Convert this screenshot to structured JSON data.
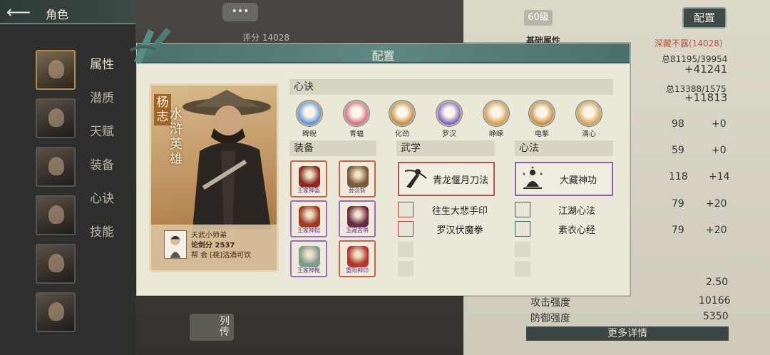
{
  "topbar": {
    "back_icon": "arrow-left-icon",
    "title": "角色"
  },
  "side_menu": [
    "属性",
    "潜质",
    "天赋",
    "装备",
    "心诀",
    "技能"
  ],
  "chat_bubble": "•••",
  "score_tag": "评分 14028",
  "lie_button": "列\n传",
  "right_panel": {
    "level": "60级",
    "config_button": "配置",
    "basic_attr_label": "基础属性",
    "rating_label": "深藏不露(14028)",
    "total1": "总81195/39954",
    "total1_plus": "+41241",
    "total2": "总13388/1575",
    "total2_plus": "+11813",
    "rows": [
      {
        "val": "98",
        "plus": "+0"
      },
      {
        "val": "59",
        "plus": "+0"
      },
      {
        "val": "118",
        "plus": "+14"
      },
      {
        "val": "79",
        "plus": "+20"
      },
      {
        "val": "79",
        "plus": "+20"
      }
    ],
    "crit_val": "2.50",
    "attack_label": "攻击强度",
    "attack_val": "10166",
    "defense_label": "防御强度",
    "defense_val": "5350",
    "more_button": "更多详情"
  },
  "modal": {
    "title": "配置",
    "hero": {
      "name": "杨志",
      "title": "水浒英雄",
      "player_title": "天武小师弟",
      "sword_score": "论剑分 2537",
      "guild": "帮    会 [桃]沽酒可饮"
    },
    "xinjue_head": "心诀",
    "xinjue": [
      {
        "label": "睥睨",
        "color": "#5a8fd6"
      },
      {
        "label": "青蝠",
        "color": "#d56a84"
      },
      {
        "label": "化劲",
        "color": "#c98a3a"
      },
      {
        "label": "罗汉",
        "color": "#7a5fc4"
      },
      {
        "label": "峥嵘",
        "color": "#d79a4e"
      },
      {
        "label": "电掣",
        "color": "#c98b3b"
      },
      {
        "label": "清心",
        "color": "#d6a052"
      }
    ],
    "equip_head": "装备",
    "equipment": [
      {
        "name": "王家神盔",
        "border": "#c1654a",
        "color": "#8a2a1f"
      },
      {
        "name": "葬念斩",
        "border": "#c1654a",
        "color": "#7a5a3a"
      },
      {
        "name": "王家神铠",
        "border": "#9a6cc0",
        "color": "#9c3a22"
      },
      {
        "name": "玉阙古带",
        "border": "#9a6cc0",
        "color": "#6b2a46"
      },
      {
        "name": "王家神靴",
        "border": "#9a6cc0",
        "color": "#7e9a8e"
      },
      {
        "name": "重阳神印",
        "border": "#c1654a",
        "color": "#b0382b"
      }
    ],
    "wuxue_head": "武学",
    "wuxue_main": "青龙偃月刀法",
    "wuxue_subs": [
      "往生大悲手印",
      "罗汉伏魔拳"
    ],
    "xinfa_head": "心法",
    "xinfa_main": "大藏神功",
    "xinfa_subs": [
      "江湖心法",
      "素衣心经"
    ]
  }
}
